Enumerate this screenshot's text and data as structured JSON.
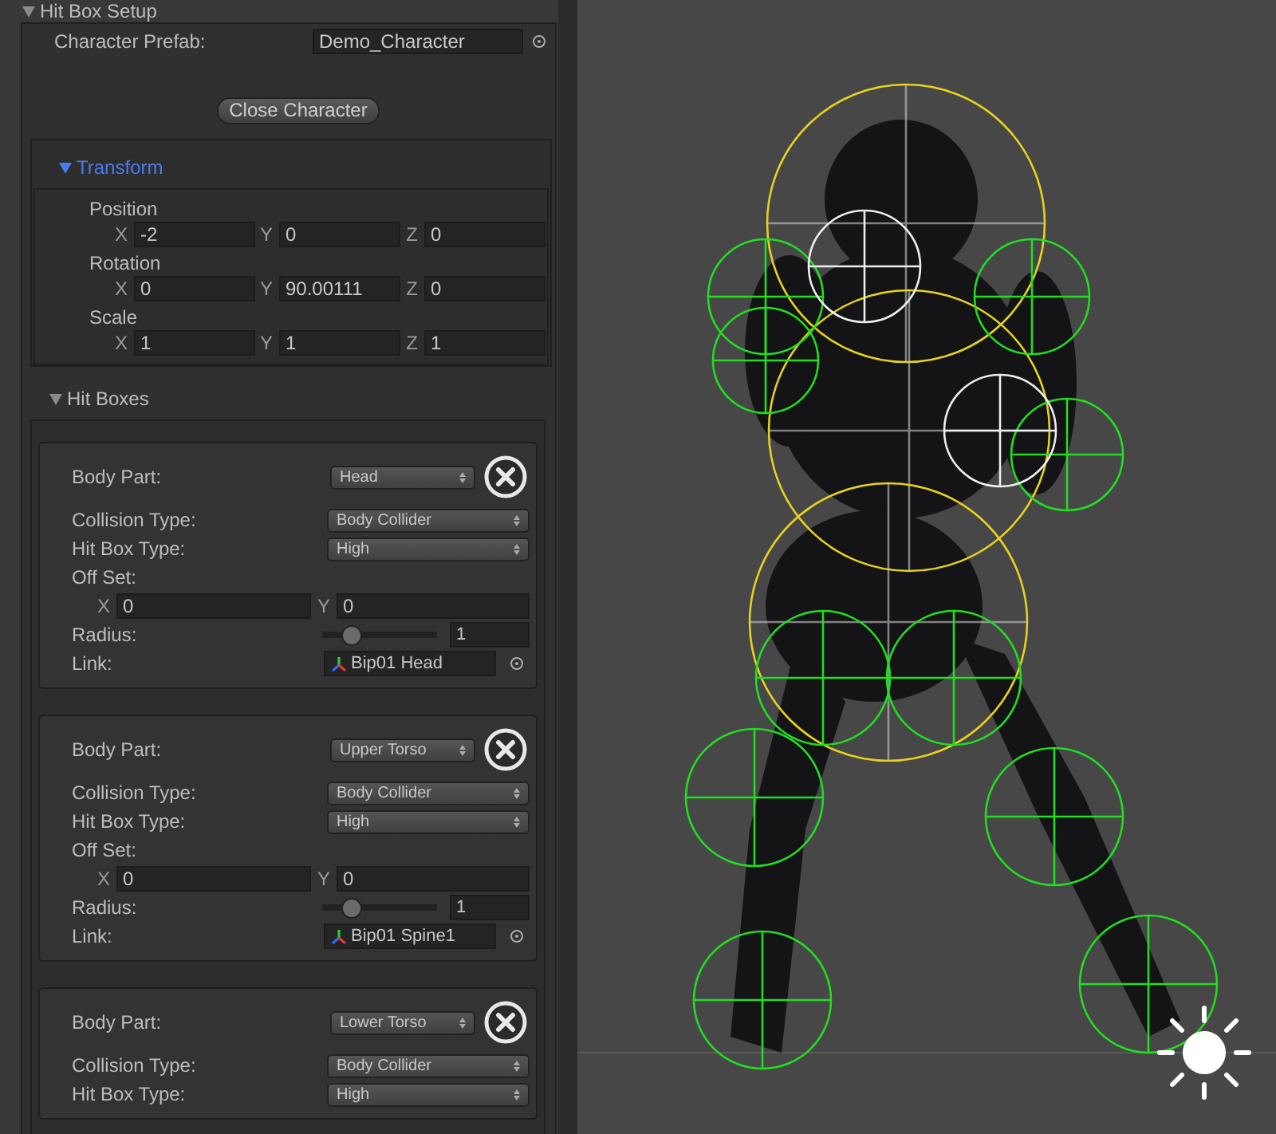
{
  "section": {
    "title": "Hit Box Setup",
    "expanded": true
  },
  "character_prefab": {
    "label": "Character Prefab:",
    "value": "Demo_Character"
  },
  "close_button": "Close Character",
  "transform": {
    "title": "Transform",
    "expanded": true,
    "groups": [
      {
        "label": "Position",
        "axes": [
          {
            "axis": "X",
            "value": "-2"
          },
          {
            "axis": "Y",
            "value": "0"
          },
          {
            "axis": "Z",
            "value": "0"
          }
        ]
      },
      {
        "label": "Rotation",
        "axes": [
          {
            "axis": "X",
            "value": "0"
          },
          {
            "axis": "Y",
            "value": "90.00111"
          },
          {
            "axis": "Z",
            "value": "0"
          }
        ]
      },
      {
        "label": "Scale",
        "axes": [
          {
            "axis": "X",
            "value": "1"
          },
          {
            "axis": "Y",
            "value": "1"
          },
          {
            "axis": "Z",
            "value": "1"
          }
        ]
      }
    ]
  },
  "hit_boxes": {
    "title": "Hit Boxes",
    "expanded": true,
    "items": [
      {
        "body_part_label": "Body Part:",
        "body_part": "Head",
        "collision_label": "Collision Type:",
        "collision": "Body Collider",
        "type_label": "Hit Box Type:",
        "type": "High",
        "offset_label": "Off Set:",
        "offset": [
          {
            "axis": "X",
            "value": "0"
          },
          {
            "axis": "Y",
            "value": "0"
          }
        ],
        "radius_label": "Radius:",
        "level": 0.2,
        "radius": "1",
        "link_label": "Link:",
        "link": "Bip01 Head"
      },
      {
        "body_part_label": "Body Part:",
        "body_part": "Upper Torso",
        "collision_label": "Collision Type:",
        "collision": "Body Collider",
        "type_label": "Hit Box Type:",
        "type": "High",
        "offset_label": "Off Set:",
        "offset": [
          {
            "axis": "X",
            "value": "0"
          },
          {
            "axis": "Y",
            "value": "0"
          }
        ],
        "radius_label": "Radius:",
        "level": 0.2,
        "radius": "1",
        "link_label": "Link:",
        "link": "Bip01 Spine1"
      },
      {
        "body_part_label": "Body Part:",
        "body_part": "Lower Torso",
        "collision_label": "Collision Type:",
        "collision": "Body Collider",
        "type_label": "Hit Box Type:",
        "type": "High"
      }
    ]
  }
}
